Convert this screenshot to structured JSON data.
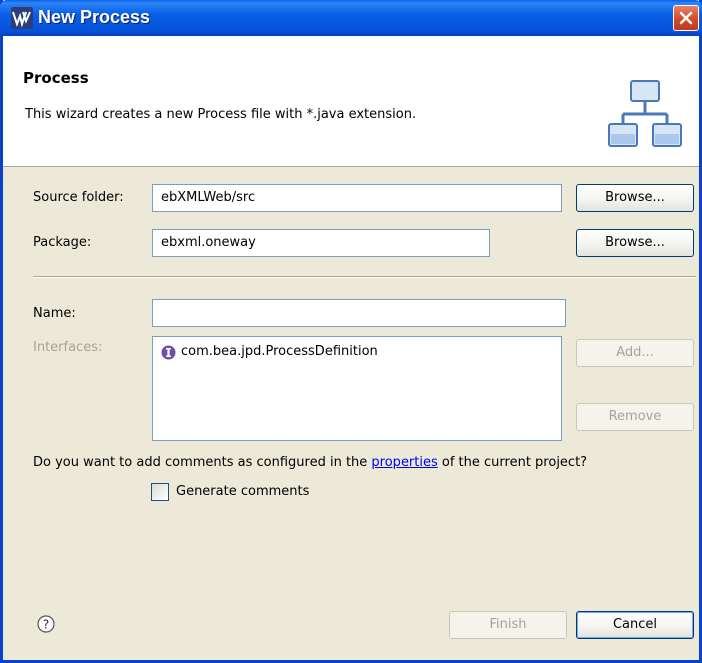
{
  "window": {
    "title": "New Process",
    "close_icon": "close-icon"
  },
  "header": {
    "title": "Process",
    "description": "This wizard creates a new Process file with *.java extension.",
    "icon": "hierarchy-icon"
  },
  "form": {
    "source_folder_label": "Source folder:",
    "source_folder_value": "ebXMLWeb/src",
    "browse1_label": "Browse...",
    "package_label": "Package:",
    "package_value": "ebxml.oneway",
    "browse2_label": "Browse...",
    "name_label": "Name:",
    "name_value": "",
    "interfaces_label": "Interfaces:",
    "interfaces": [
      {
        "label": "com.bea.jpd.ProcessDefinition",
        "icon": "interface-icon"
      }
    ],
    "add_label": "Add...",
    "remove_label": "Remove"
  },
  "comments": {
    "question_pre": "Do you want to add comments as configured in the ",
    "link_text": "properties",
    "question_post": " of the current project?",
    "checkbox_label": "Generate comments",
    "checked": false
  },
  "footer": {
    "help_icon": "help-icon",
    "finish_label": "Finish",
    "cancel_label": "Cancel"
  },
  "colors": {
    "titlebar": "#0a5ee6",
    "dialog_bg": "#ece9d8",
    "close_button": "#d6482a",
    "link": "#0000ee"
  }
}
